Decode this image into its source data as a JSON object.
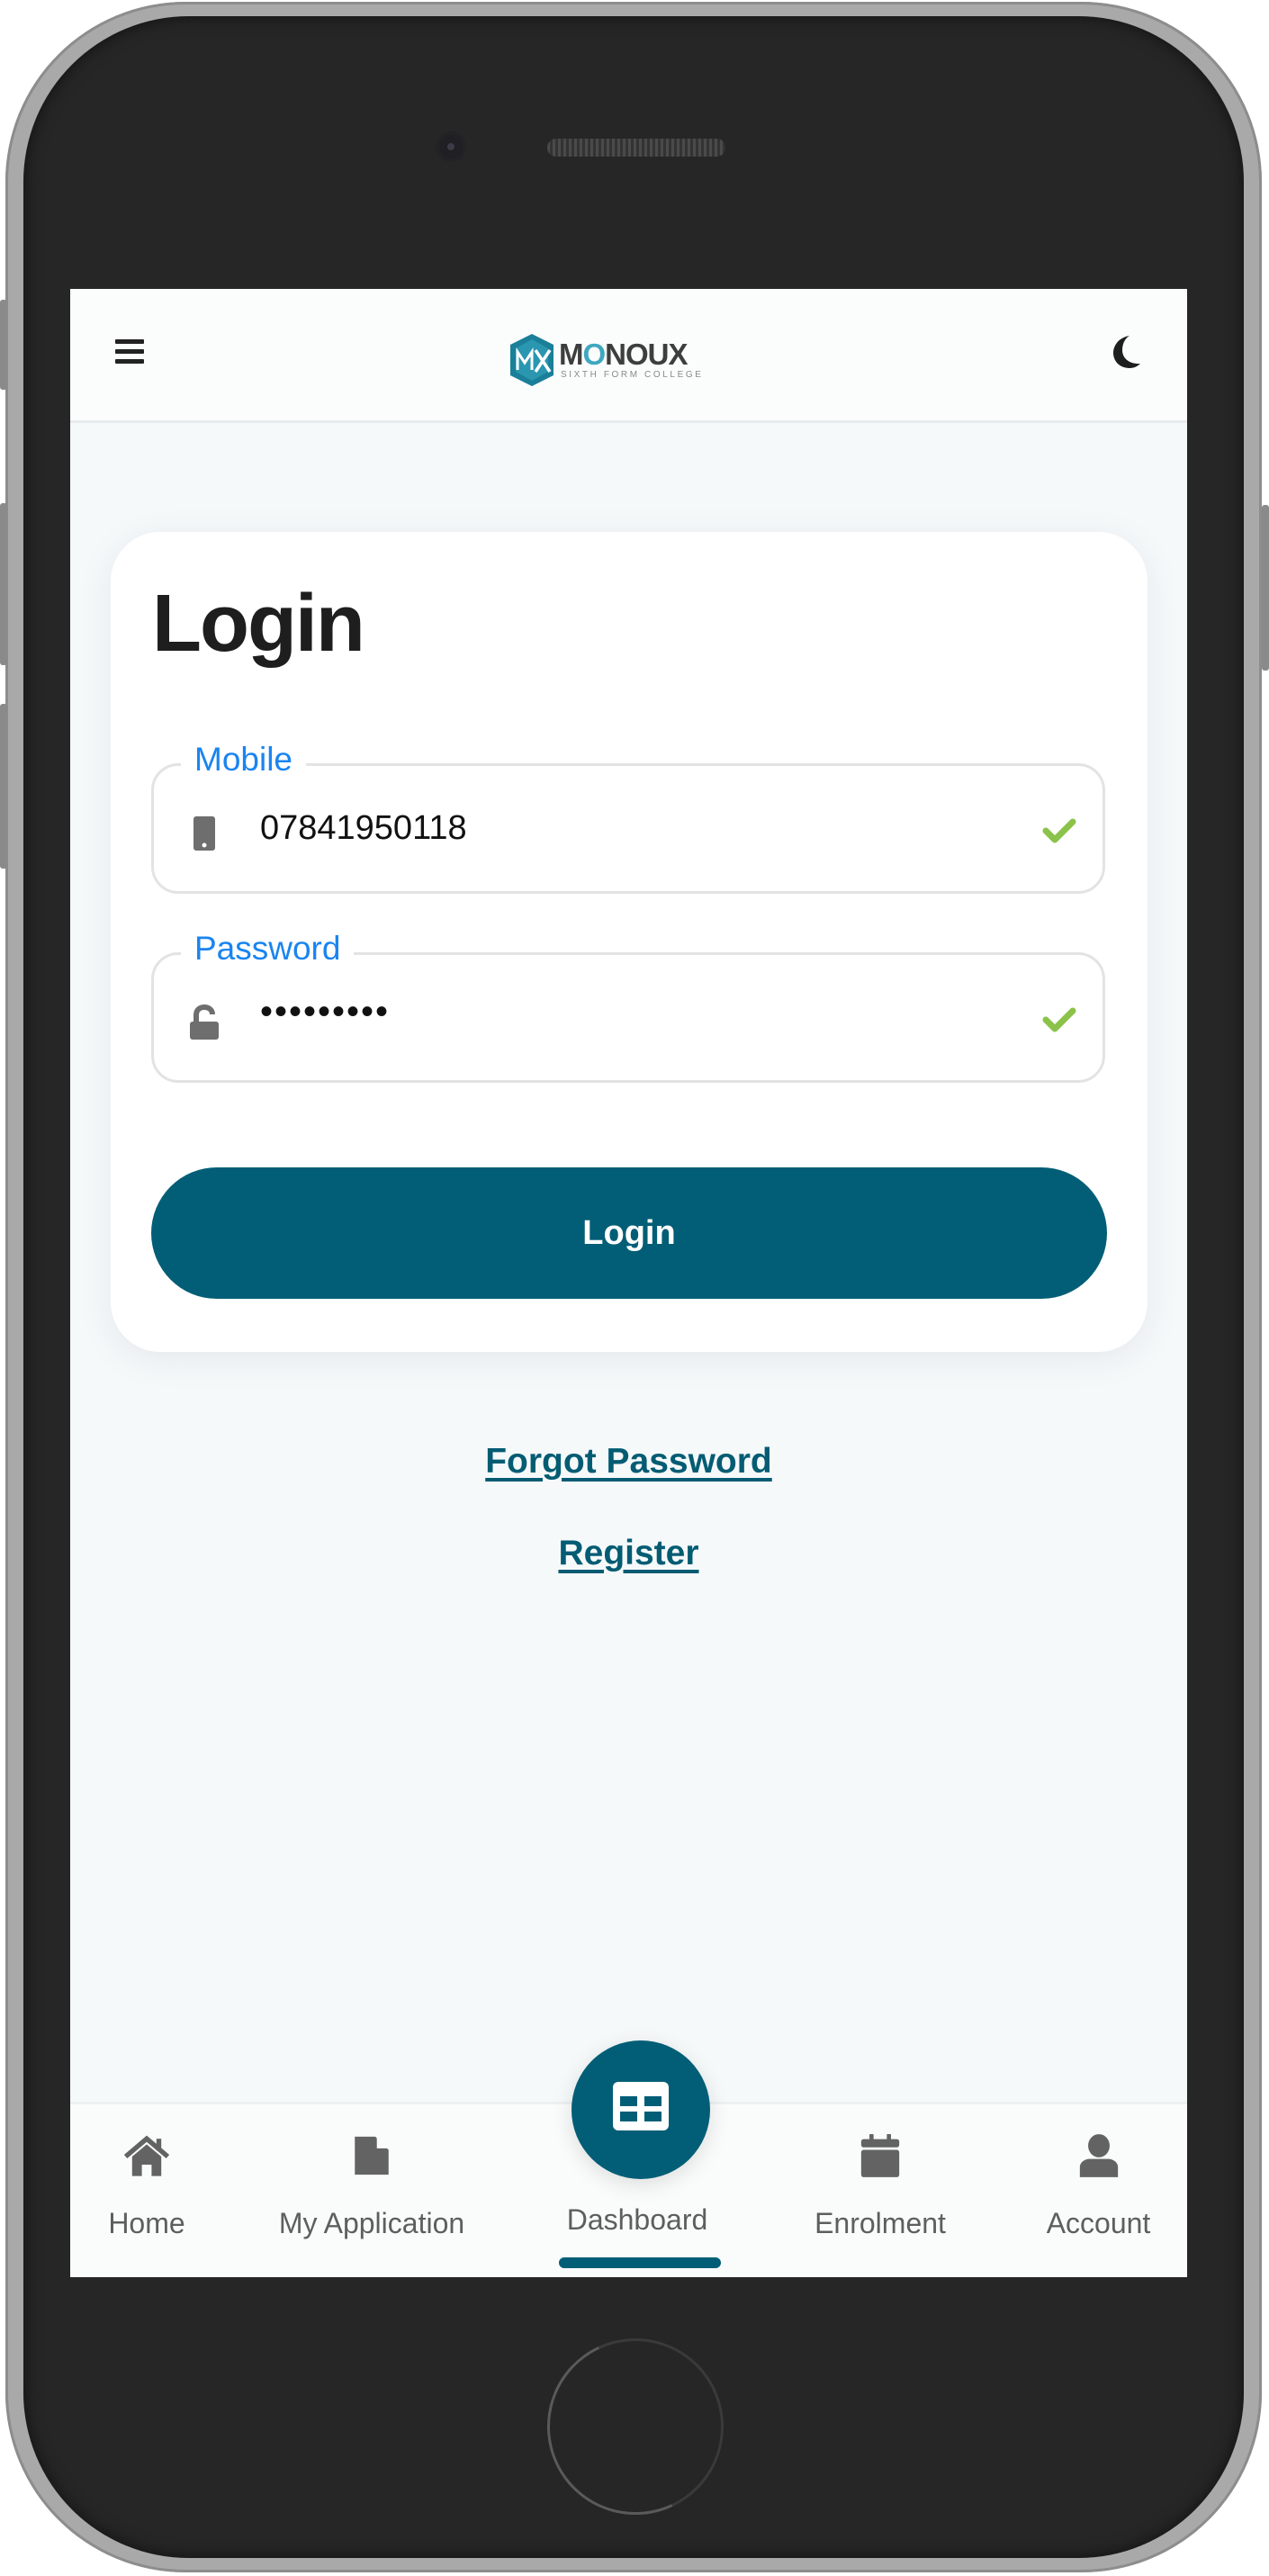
{
  "header": {
    "menu_icon": "hamburger-menu-icon",
    "logo": {
      "wordmark_prefix": "M",
      "wordmark_o": "O",
      "wordmark_suffix": "NOUX",
      "subtitle": "SIXTH FORM COLLEGE",
      "mark_letters": "MX"
    },
    "theme_toggle_icon": "moon-icon"
  },
  "login_card": {
    "title": "Login",
    "fields": [
      {
        "label": "Mobile",
        "value": "07841950118",
        "icon": "mobile-phone-icon",
        "status_icon": "check-icon",
        "valid": true
      },
      {
        "label": "Password",
        "value": "•••••••••",
        "icon": "unlock-icon",
        "status_icon": "check-icon",
        "valid": true
      }
    ],
    "submit_label": "Login"
  },
  "links": {
    "forgot_password": "Forgot Password",
    "register": "Register"
  },
  "bottom_nav": {
    "items": [
      {
        "label": "Home",
        "icon": "home-icon"
      },
      {
        "label": "My Application",
        "icon": "document-icon"
      },
      {
        "label": "Dashboard",
        "icon": "dashboard-grid-icon",
        "active": true
      },
      {
        "label": "Enrolment",
        "icon": "calendar-icon"
      },
      {
        "label": "Account",
        "icon": "user-icon"
      }
    ]
  },
  "colors": {
    "brand": "#025e76",
    "field_label": "#1a84f0",
    "valid": "#8bc34a",
    "logo_accent": "#3fa7c0"
  }
}
